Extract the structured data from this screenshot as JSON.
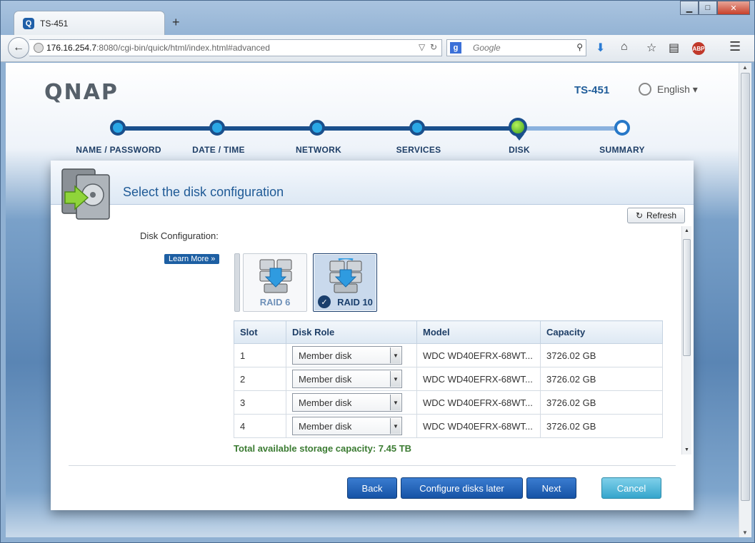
{
  "browser": {
    "tab_title": "TS-451",
    "tab_icon": "Q",
    "new_tab": "+",
    "url_host": "176.16.254.7",
    "url_path": ":8080/cgi-bin/quick/html/index.html#advanced",
    "search_placeholder": "Google"
  },
  "header": {
    "logo": "QNAP",
    "model": "TS-451",
    "language": "English ▾"
  },
  "steps": [
    {
      "label": "NAME / PASSWORD",
      "state": "done"
    },
    {
      "label": "DATE / TIME",
      "state": "done"
    },
    {
      "label": "NETWORK",
      "state": "done"
    },
    {
      "label": "SERVICES",
      "state": "done"
    },
    {
      "label": "DISK",
      "state": "current"
    },
    {
      "label": "SUMMARY",
      "state": "todo"
    }
  ],
  "panel": {
    "title": "Select the disk configuration",
    "refresh_label": "Refresh",
    "disk_config_label": "Disk Configuration:",
    "learn_more": "Learn More »",
    "raid_options": [
      {
        "label": "RAID 6",
        "selected": false
      },
      {
        "label": "RAID 10",
        "selected": true
      }
    ],
    "table": {
      "headers": [
        "Slot",
        "Disk Role",
        "Model",
        "Capacity"
      ],
      "rows": [
        {
          "slot": "1",
          "role": "Member disk",
          "model": "WDC WD40EFRX-68WT...",
          "capacity": "3726.02 GB"
        },
        {
          "slot": "2",
          "role": "Member disk",
          "model": "WDC WD40EFRX-68WT...",
          "capacity": "3726.02 GB"
        },
        {
          "slot": "3",
          "role": "Member disk",
          "model": "WDC WD40EFRX-68WT...",
          "capacity": "3726.02 GB"
        },
        {
          "slot": "4",
          "role": "Member disk",
          "model": "WDC WD40EFRX-68WT...",
          "capacity": "3726.02 GB"
        }
      ]
    },
    "total_capacity": "Total available storage capacity: 7.45 TB"
  },
  "buttons": {
    "back": "Back",
    "configure_later": "Configure disks later",
    "next": "Next",
    "cancel": "Cancel"
  },
  "colors": {
    "accent": "#1a4f8c",
    "current_step": "#3da11b",
    "total_text": "#3b7b32",
    "cancel_button": "#35a5cc"
  }
}
